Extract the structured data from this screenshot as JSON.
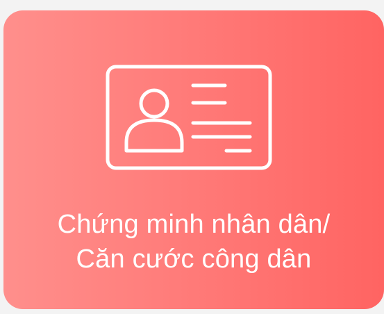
{
  "card": {
    "icon": "id-card-icon",
    "label_line1": "Chứng minh nhân dân/",
    "label_line2": "Căn cước công dân",
    "colors": {
      "gradient_start": "#ff8f8c",
      "gradient_end": "#ff6462",
      "foreground": "#ffffff",
      "page_background": "#f3f3f3"
    }
  }
}
